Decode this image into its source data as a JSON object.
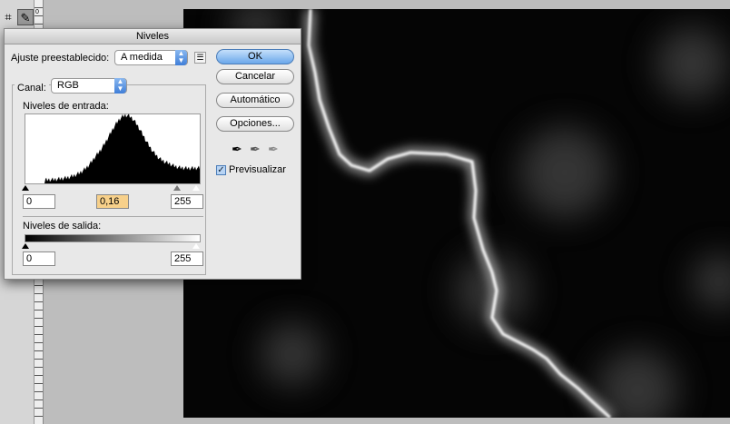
{
  "dialog": {
    "title": "Niveles",
    "preset_label": "Ajuste preestablecido:",
    "preset_value": "A medida",
    "channel_label": "Canal:",
    "channel_value": "RGB",
    "input_levels_label": "Niveles de entrada:",
    "input_black": "0",
    "input_gamma": "0,16",
    "input_white": "255",
    "output_levels_label": "Niveles de salida:",
    "output_black": "0",
    "output_white": "255",
    "buttons": {
      "ok": "OK",
      "cancel": "Cancelar",
      "auto": "Automático",
      "options": "Opciones..."
    },
    "preview_label": "Previsualizar",
    "preview_checked": true,
    "accent": "#6aa7ea",
    "gamma_highlight": "#f7d08a"
  },
  "ruler": {
    "mark": "0"
  }
}
